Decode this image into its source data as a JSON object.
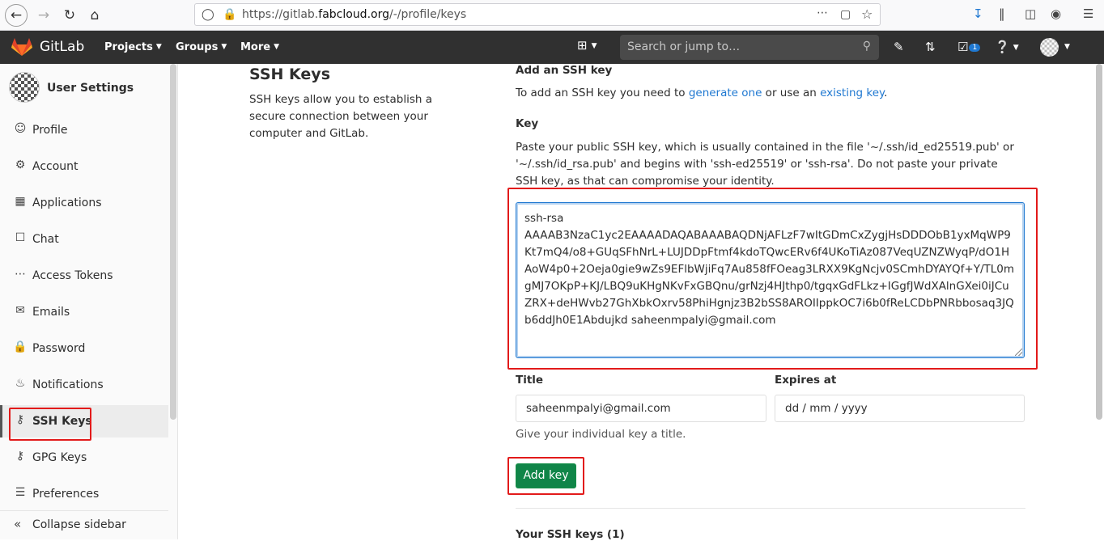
{
  "browser": {
    "url_prefix": "https://gitlab.",
    "url_domain": "fabcloud.org",
    "url_path": "/-/profile/keys",
    "back_icon": "back-arrow-icon",
    "forward_icon": "forward-arrow-icon",
    "reload_icon": "reload-icon",
    "home_icon": "home-icon"
  },
  "header": {
    "brand": "GitLab",
    "menus": [
      "Projects",
      "Groups",
      "More"
    ],
    "search_placeholder": "Search or jump to…",
    "todo_count": "1",
    "accent": "#303030"
  },
  "sidebar": {
    "title": "User Settings",
    "items": [
      {
        "label": "Profile",
        "icon": "profile-icon"
      },
      {
        "label": "Account",
        "icon": "account-icon"
      },
      {
        "label": "Applications",
        "icon": "applications-icon"
      },
      {
        "label": "Chat",
        "icon": "chat-icon"
      },
      {
        "label": "Access Tokens",
        "icon": "token-icon"
      },
      {
        "label": "Emails",
        "icon": "email-icon"
      },
      {
        "label": "Password",
        "icon": "lock-icon"
      },
      {
        "label": "Notifications",
        "icon": "bell-icon"
      },
      {
        "label": "SSH Keys",
        "icon": "key-icon",
        "active": true
      },
      {
        "label": "GPG Keys",
        "icon": "key-icon"
      },
      {
        "label": "Preferences",
        "icon": "preferences-icon"
      }
    ],
    "collapse_label": "Collapse sidebar"
  },
  "main": {
    "section_title": "SSH Keys",
    "section_desc": "SSH keys allow you to establish a secure connection between your computer and GitLab.",
    "add_heading": "Add an SSH key",
    "add_intro_pre": "To add an SSH key you need to ",
    "add_intro_link1": "generate one",
    "add_intro_mid": " or use an ",
    "add_intro_link2": "existing key",
    "add_intro_post": ".",
    "key_label": "Key",
    "key_help": "Paste your public SSH key, which is usually contained in the file '~/.ssh/id_ed25519.pub' or '~/.ssh/id_rsa.pub' and begins with 'ssh-ed25519' or 'ssh-rsa'. Do not paste your private SSH key, as that can compromise your identity.",
    "key_value_line1": "ssh-rsa",
    "key_value_rest": "AAAAB3NzaC1yc2EAAAADAQABAAABAQDNjAFLzF7wItGDmCxZygjHsDDDObB1yxMqWP9Kt7mQ4/o8+GUqSFhNrL+LUJDDpFtmf4kdoTQwcERv6f4UKoTiAz087VeqUZNZWyqP/dO1HAoW4p0+2Oeja0gie9wZs9EFlbWjiFq7Au858fFOeag3LRXX9KgNcjv0SCmhDYAYQf+Y/TL0mgMJ7OKpP+KJ/LBQ9uKHgNKvFxGBQnu/grNzj4HJthp0/tgqxGdFLkz+IGgfJWdXAlnGXei0iJCuZRX+deHWvb27GhXbkOxrv58PhiHgnjz3B2bSS8AROIIppkOC7i6b0fReLCDbPNRbbosaq3JQb6ddJh0E1Abdujkd saheenmpalyi@gmail.com",
    "title_label": "Title",
    "title_value": "saheenmpalyi@gmail.com",
    "title_help": "Give your individual key a title.",
    "expires_label": "Expires at",
    "expires_placeholder": "dd / mm / yyyy",
    "add_button": "Add key",
    "your_keys": "Your SSH keys (1)"
  }
}
